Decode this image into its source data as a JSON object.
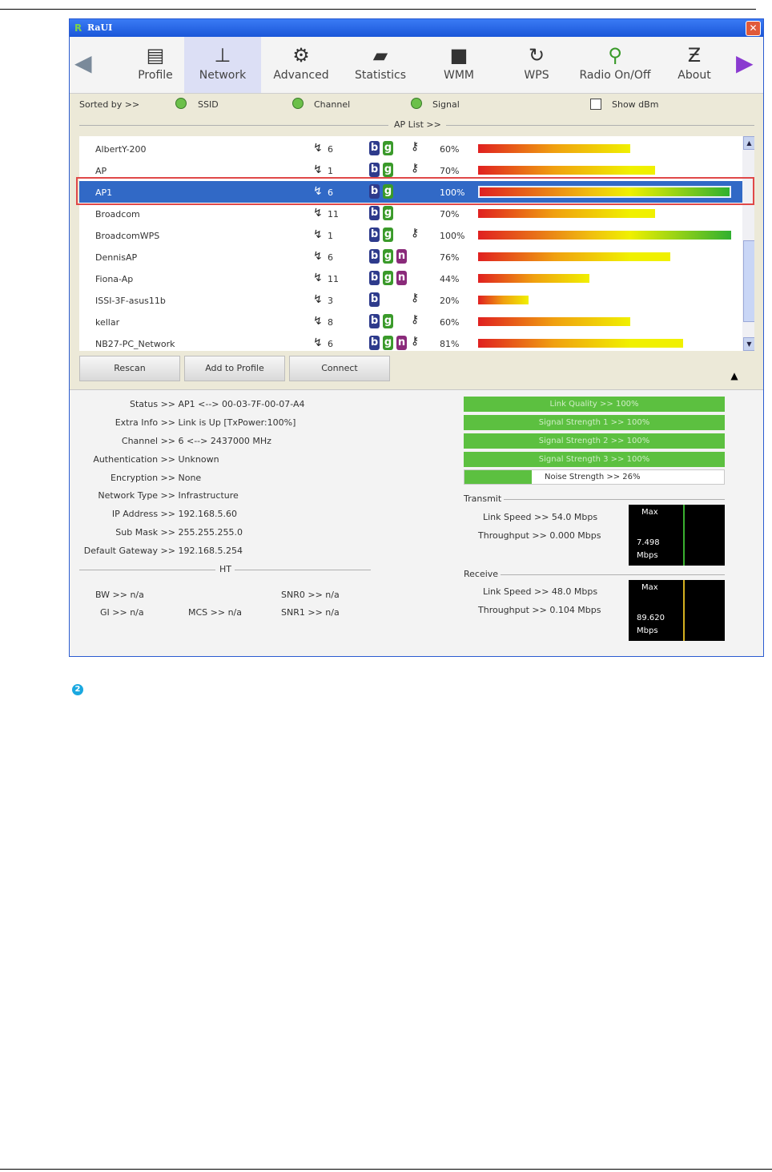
{
  "window": {
    "title": "RaUI",
    "close_glyph": "✕"
  },
  "toolbar": {
    "items": [
      {
        "label": "Profile",
        "icon": "profile-icon"
      },
      {
        "label": "Network",
        "icon": "network-icon"
      },
      {
        "label": "Advanced",
        "icon": "advanced-icon"
      },
      {
        "label": "Statistics",
        "icon": "statistics-icon"
      },
      {
        "label": "WMM",
        "icon": "wmm-icon"
      },
      {
        "label": "WPS",
        "icon": "wps-icon"
      },
      {
        "label": "Radio On/Off",
        "icon": "radio-icon"
      },
      {
        "label": "About",
        "icon": "about-icon"
      }
    ],
    "active": "Network"
  },
  "sort": {
    "label": "Sorted by >>",
    "ssid": "SSID",
    "channel": "Channel",
    "signal": "Signal",
    "show_dbm": "Show dBm"
  },
  "ap_list": {
    "label": "AP List >>",
    "rows": [
      {
        "ssid": "AlbertY-200",
        "channel": "6",
        "modes": [
          "b",
          "g"
        ],
        "locked": true,
        "signal": 60
      },
      {
        "ssid": "AP",
        "channel": "1",
        "modes": [
          "b",
          "g"
        ],
        "locked": true,
        "signal": 70
      },
      {
        "ssid": "AP1",
        "channel": "6",
        "modes": [
          "b",
          "g"
        ],
        "locked": false,
        "signal": 100,
        "selected": true
      },
      {
        "ssid": "Broadcom",
        "channel": "11",
        "modes": [
          "b",
          "g"
        ],
        "locked": false,
        "signal": 70
      },
      {
        "ssid": "BroadcomWPS",
        "channel": "1",
        "modes": [
          "b",
          "g"
        ],
        "locked": true,
        "signal": 100
      },
      {
        "ssid": "DennisAP",
        "channel": "6",
        "modes": [
          "b",
          "g",
          "n"
        ],
        "locked": false,
        "signal": 76
      },
      {
        "ssid": "Fiona-Ap",
        "channel": "11",
        "modes": [
          "b",
          "g",
          "n"
        ],
        "locked": false,
        "signal": 44
      },
      {
        "ssid": "ISSI-3F-asus11b",
        "channel": "3",
        "modes": [
          "b"
        ],
        "locked": true,
        "signal": 20
      },
      {
        "ssid": "kellar",
        "channel": "8",
        "modes": [
          "b",
          "g"
        ],
        "locked": true,
        "signal": 60
      },
      {
        "ssid": "NB27-PC_Network",
        "channel": "6",
        "modes": [
          "b",
          "g",
          "n"
        ],
        "locked": true,
        "signal": 81
      }
    ]
  },
  "buttons": {
    "rescan": "Rescan",
    "add_to_profile": "Add to Profile",
    "connect": "Connect"
  },
  "status": {
    "status_k": "Status >>",
    "status_v": "AP1 <--> 00-03-7F-00-07-A4",
    "extra_k": "Extra Info >>",
    "extra_v": "Link is Up [TxPower:100%]",
    "channel_k": "Channel >>",
    "channel_v": "6 <--> 2437000 MHz",
    "auth_k": "Authentication >>",
    "auth_v": "Unknown",
    "enc_k": "Encryption >>",
    "enc_v": "None",
    "nettype_k": "Network Type >>",
    "nettype_v": "Infrastructure",
    "ip_k": "IP Address >>",
    "ip_v": "192.168.5.60",
    "mask_k": "Sub Mask >>",
    "mask_v": "255.255.255.0",
    "gw_k": "Default Gateway >>",
    "gw_v": "192.168.5.254"
  },
  "ht": {
    "label": "HT",
    "bw": "BW >> n/a",
    "gi": "GI >> n/a",
    "mcs": "MCS >> n/a",
    "snr0": "SNR0 >> n/a",
    "snr1": "SNR1 >> n/a"
  },
  "quality": {
    "link_quality": "Link Quality >> 100%",
    "signal1": "Signal Strength 1 >> 100%",
    "signal2": "Signal Strength 2 >> 100%",
    "signal3": "Signal Strength 3 >> 100%",
    "noise": "Noise Strength >> 26%",
    "noise_level": 26
  },
  "transmit": {
    "label": "Transmit",
    "link_speed": "Link Speed >> 54.0 Mbps",
    "throughput": "Throughput >> 0.000 Mbps",
    "graph_max": "Max",
    "graph_val": "7.498",
    "graph_unit": "Mbps"
  },
  "receive": {
    "label": "Receive",
    "link_speed": "Link Speed >> 48.0 Mbps",
    "throughput": "Throughput >> 0.104 Mbps",
    "graph_max": "Max",
    "graph_val": "89.620",
    "graph_unit": "Mbps"
  },
  "step_number": "2",
  "colors": {
    "selection": "#3169c6",
    "highlight_border": "#e04848",
    "quality_green": "#5cc040"
  }
}
